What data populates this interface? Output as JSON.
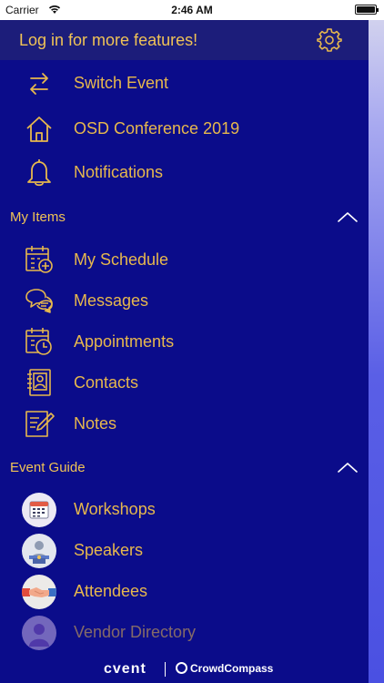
{
  "status_bar": {
    "carrier": "Carrier",
    "time": "2:46 AM"
  },
  "header": {
    "login_text": "Log in for more features!",
    "settings_icon": "gear-icon"
  },
  "top_items": [
    {
      "label": "Switch Event",
      "icon": "switch-arrows-icon"
    },
    {
      "label": "OSD Conference 2019",
      "icon": "home-icon"
    },
    {
      "label": "Notifications",
      "icon": "bell-icon"
    }
  ],
  "sections": {
    "my_items": {
      "title": "My Items",
      "items": [
        {
          "label": "My Schedule",
          "icon": "calendar-add-icon"
        },
        {
          "label": "Messages",
          "icon": "chat-bubbles-icon"
        },
        {
          "label": "Appointments",
          "icon": "calendar-clock-icon"
        },
        {
          "label": "Contacts",
          "icon": "address-book-icon"
        },
        {
          "label": "Notes",
          "icon": "note-pencil-icon"
        }
      ]
    },
    "event_guide": {
      "title": "Event Guide",
      "items": [
        {
          "label": "Workshops",
          "icon": "workshops-calendar-icon"
        },
        {
          "label": "Speakers",
          "icon": "speaker-icon"
        },
        {
          "label": "Attendees",
          "icon": "handshake-icon"
        },
        {
          "label": "Vendor Directory",
          "icon": "vendor-icon"
        }
      ]
    }
  },
  "footer": {
    "brand": "cvent",
    "product": "CrowdCompass"
  },
  "colors": {
    "background": "#0b0c8a",
    "header": "#1c1d7a",
    "accent": "#e7b84d",
    "panel_edge": "#4a50e2"
  }
}
